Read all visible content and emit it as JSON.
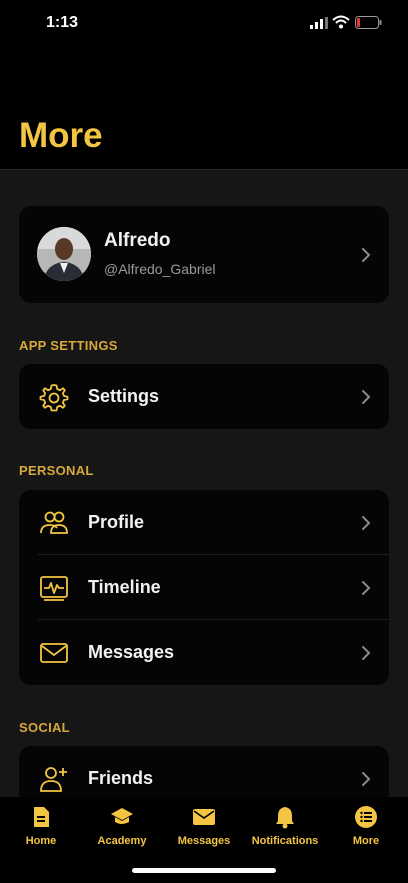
{
  "status_bar": {
    "time": "1:13"
  },
  "page_title": "More",
  "profile": {
    "name": "Alfredo",
    "handle": "@Alfredo_Gabriel"
  },
  "sections": {
    "app_settings": {
      "title": "APP SETTINGS",
      "items": [
        {
          "label": "Settings",
          "icon": "gear-icon"
        }
      ]
    },
    "personal": {
      "title": "PERSONAL",
      "items": [
        {
          "label": "Profile",
          "icon": "users-icon"
        },
        {
          "label": "Timeline",
          "icon": "timeline-icon"
        },
        {
          "label": "Messages",
          "icon": "envelope-icon"
        }
      ]
    },
    "social": {
      "title": "SOCIAL",
      "items": [
        {
          "label": "Friends",
          "icon": "add-friend-icon"
        }
      ]
    }
  },
  "tab_bar": [
    {
      "label": "Home",
      "icon": "document-icon"
    },
    {
      "label": "Academy",
      "icon": "graduation-cap-icon"
    },
    {
      "label": "Messages",
      "icon": "envelope-icon"
    },
    {
      "label": "Notifications",
      "icon": "bell-icon"
    },
    {
      "label": "More",
      "icon": "list-icon"
    }
  ],
  "colors": {
    "accent": "#f4c542",
    "section_header": "#d6a93a",
    "card": "#050505",
    "background": "#161616"
  }
}
